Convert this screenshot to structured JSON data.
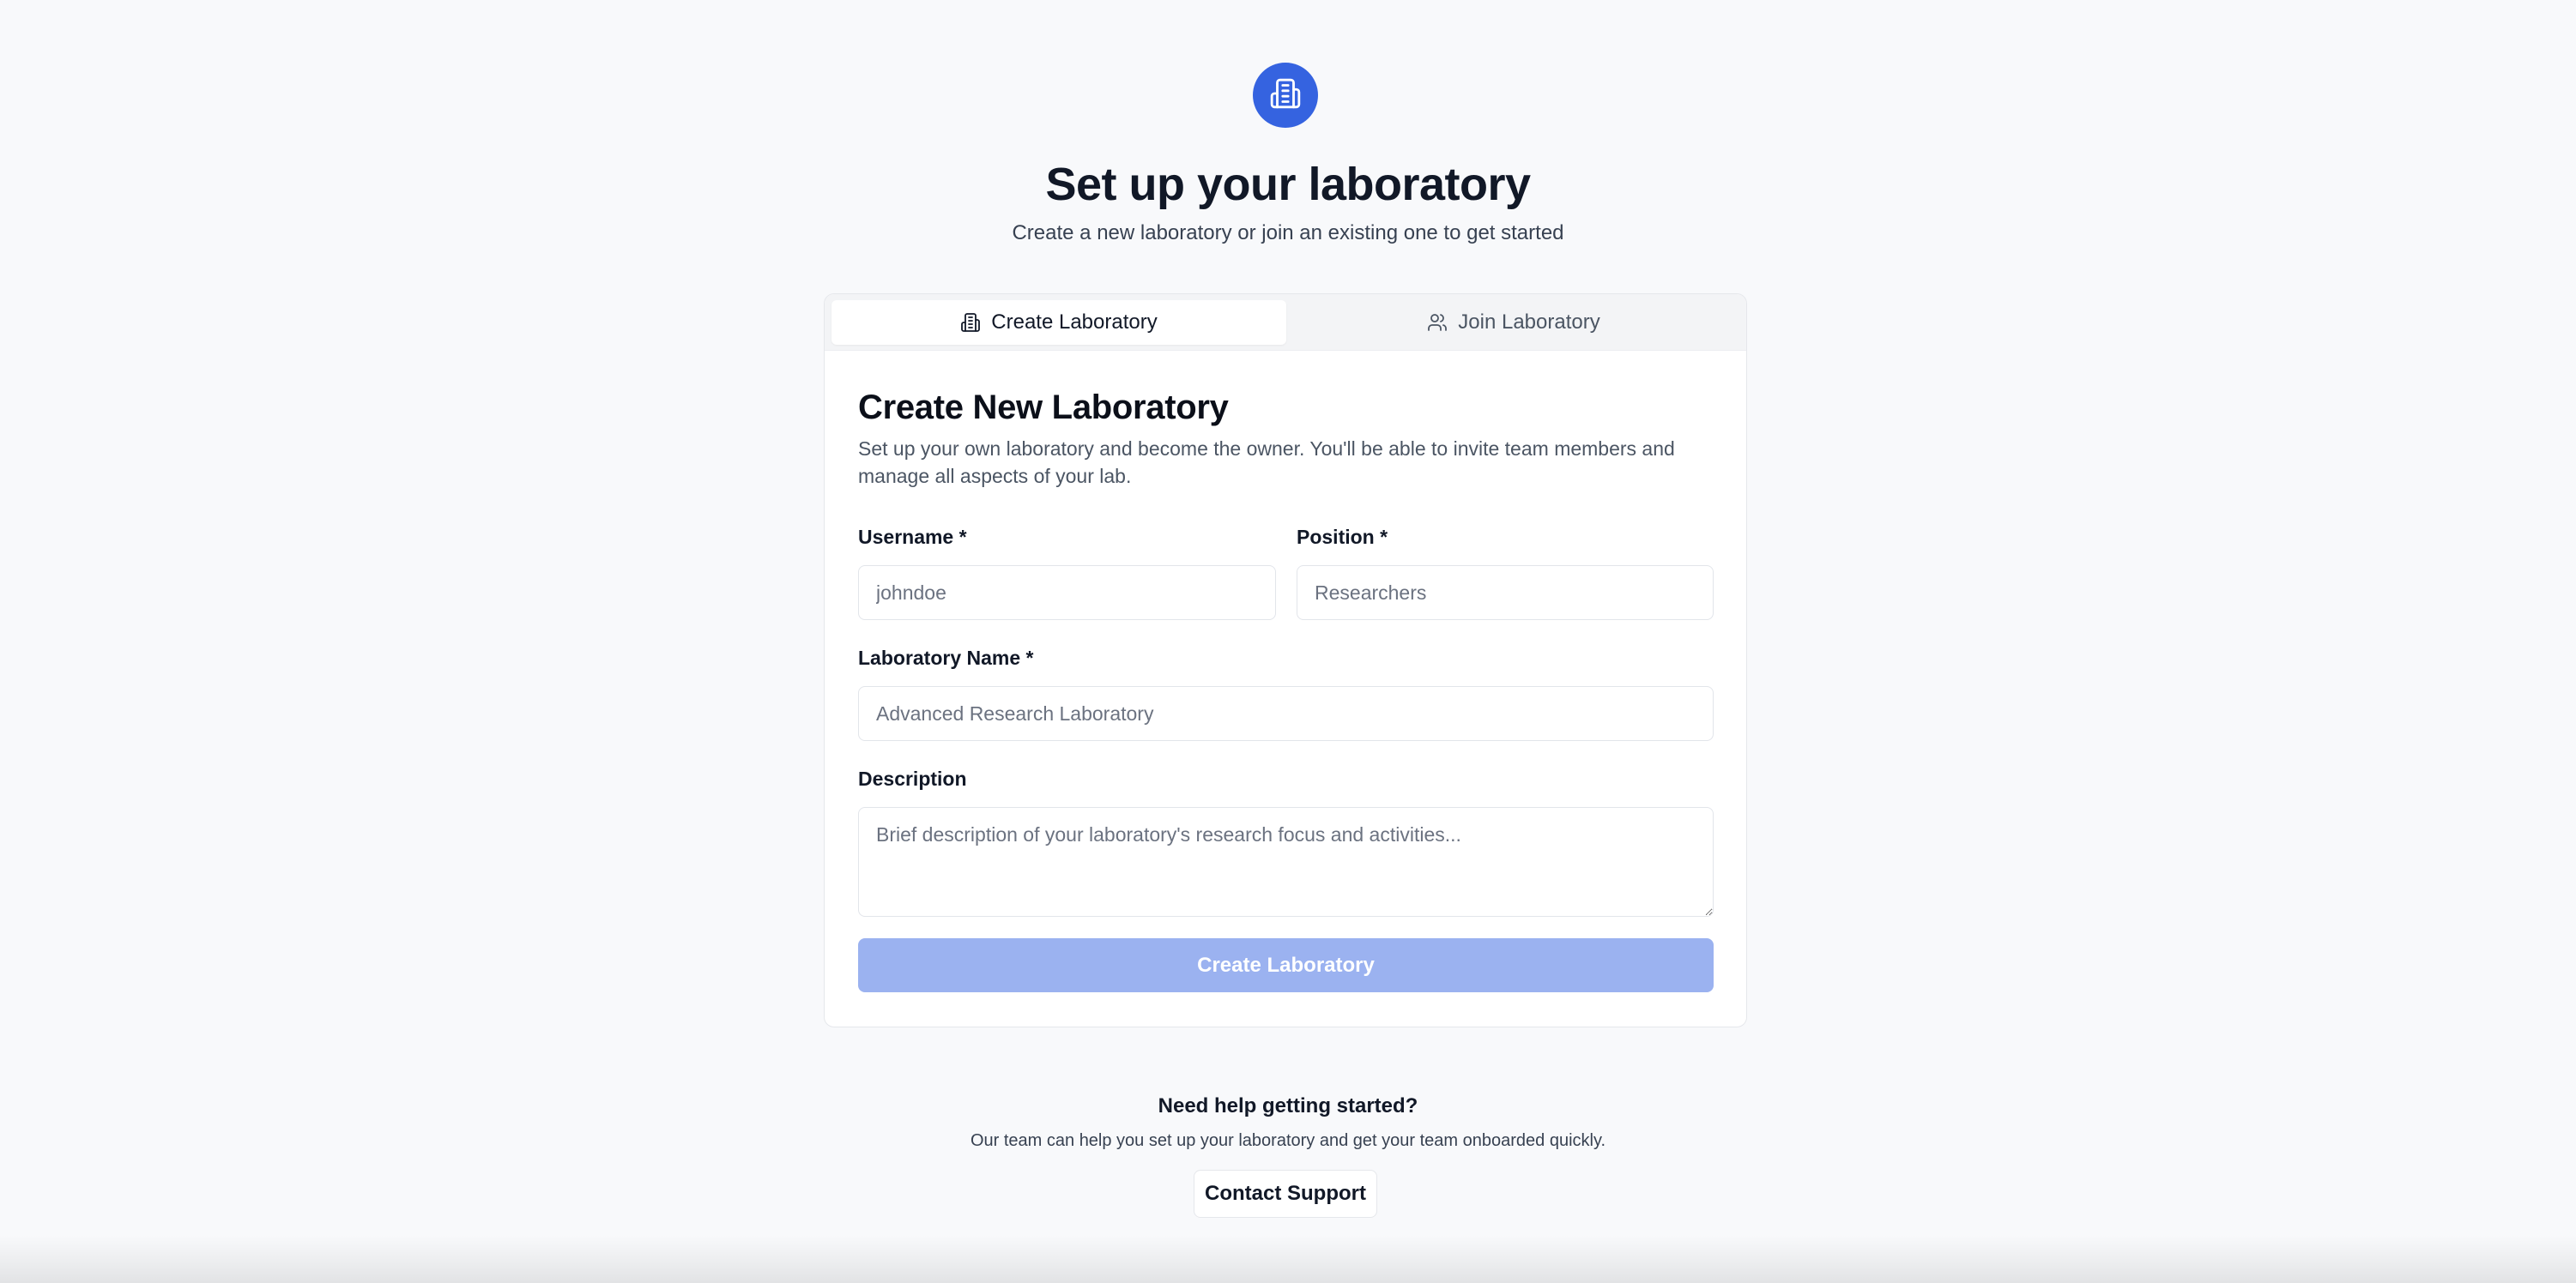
{
  "header": {
    "logo_icon": "building-icon",
    "title": "Set up your laboratory",
    "subtitle": "Create a new laboratory or join an existing one to get started"
  },
  "tabs": [
    {
      "label": "Create Laboratory",
      "icon": "building-icon",
      "active": true
    },
    {
      "label": "Join Laboratory",
      "icon": "users-icon",
      "active": false
    }
  ],
  "form": {
    "title": "Create New Laboratory",
    "description": "Set up your own laboratory and become the owner. You'll be able to invite team members and manage all aspects of your lab.",
    "username": {
      "label": "Username *",
      "placeholder": "johndoe",
      "value": ""
    },
    "position": {
      "label": "Position *",
      "placeholder": "Researchers",
      "value": ""
    },
    "lab_name": {
      "label": "Laboratory Name *",
      "placeholder": "Advanced Research Laboratory",
      "value": ""
    },
    "description_field": {
      "label": "Description",
      "placeholder": "Brief description of your laboratory's research focus and activities...",
      "value": ""
    },
    "submit_label": "Create Laboratory",
    "submit_disabled": true
  },
  "help": {
    "title": "Need help getting started?",
    "text": "Our team can help you set up your laboratory and get your team onboarded quickly.",
    "contact_label": "Contact Support"
  },
  "colors": {
    "accent": "#3563e0",
    "accent_disabled": "#9bb2f0",
    "background": "#f8f9fb"
  }
}
